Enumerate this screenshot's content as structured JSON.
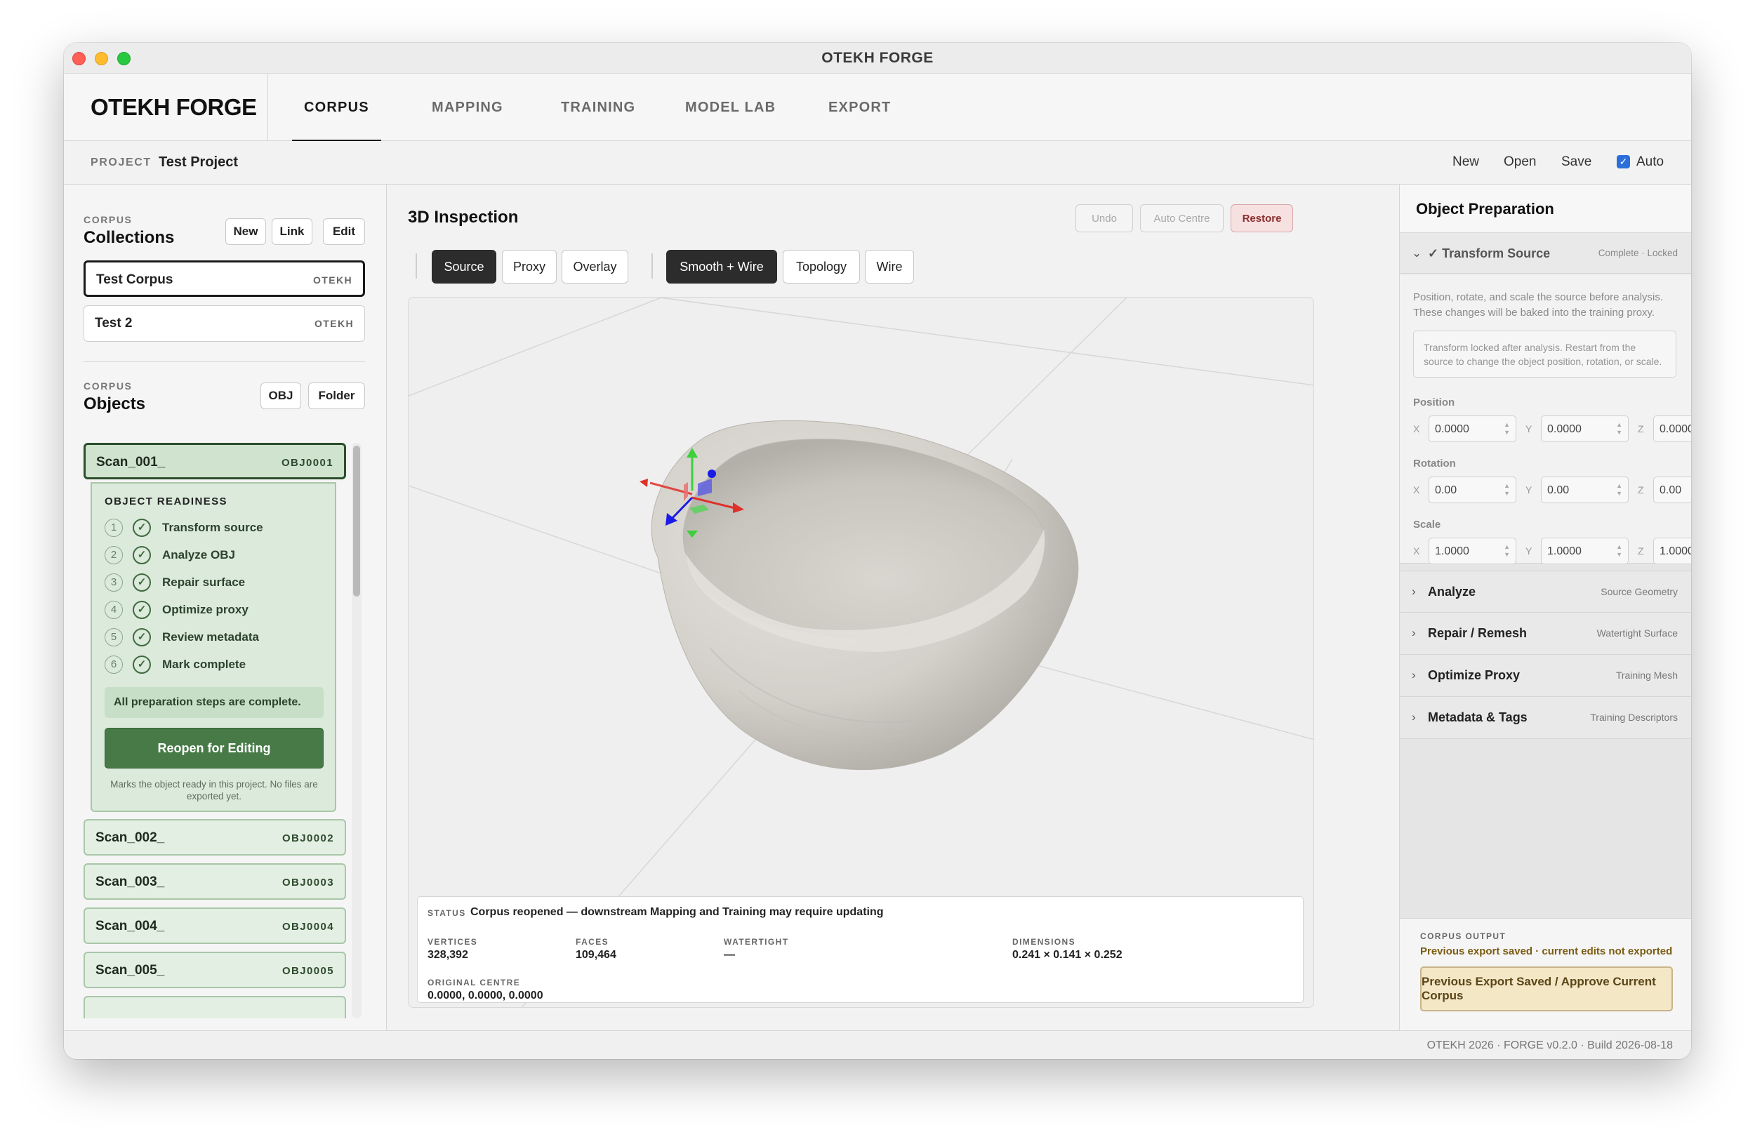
{
  "window": {
    "title": "OTEKH FORGE"
  },
  "app": {
    "logo": "OTEKH FORGE"
  },
  "nav": {
    "tabs": [
      "CORPUS",
      "MAPPING",
      "TRAINING",
      "MODEL LAB",
      "EXPORT"
    ],
    "active": "CORPUS"
  },
  "project": {
    "label": "PROJECT",
    "name": "Test Project",
    "new": "New",
    "open": "Open",
    "save": "Save",
    "auto_label": "Auto",
    "auto_checked": true
  },
  "collections": {
    "section_label": "CORPUS",
    "title": "Collections",
    "buttons": [
      "New",
      "Link",
      "Edit"
    ],
    "items": [
      {
        "name": "Test Corpus",
        "code": "OTEKH",
        "active": true
      },
      {
        "name": "Test 2",
        "code": "OTEKH",
        "active": false
      }
    ]
  },
  "objects": {
    "section_label": "CORPUS",
    "title": "Objects",
    "buttons": [
      "OBJ",
      "Folder"
    ],
    "items": [
      {
        "name": "Scan_001_",
        "code": "OBJ0001",
        "active": true
      },
      {
        "name": "Scan_002_",
        "code": "OBJ0002",
        "active": false
      },
      {
        "name": "Scan_003_",
        "code": "OBJ0003",
        "active": false
      },
      {
        "name": "Scan_004_",
        "code": "OBJ0004",
        "active": false
      },
      {
        "name": "Scan_005_",
        "code": "OBJ0005",
        "active": false
      }
    ],
    "readiness": {
      "title": "OBJECT READINESS",
      "steps": [
        {
          "num": "1",
          "label": "Transform source"
        },
        {
          "num": "2",
          "label": "Analyze OBJ"
        },
        {
          "num": "3",
          "label": "Repair surface"
        },
        {
          "num": "4",
          "label": "Optimize proxy"
        },
        {
          "num": "5",
          "label": "Review metadata"
        },
        {
          "num": "6",
          "label": "Mark complete"
        }
      ],
      "complete_message": "All preparation steps are complete.",
      "reopen_button": "Reopen for Editing",
      "note": "Marks the object ready in this project. No files are exported yet."
    }
  },
  "inspection": {
    "title": "3D Inspection",
    "toolbar": {
      "undo": "Undo",
      "auto_centre": "Auto Centre",
      "restore": "Restore"
    },
    "source_modes": [
      "Source",
      "Proxy",
      "Overlay"
    ],
    "source_active": "Source",
    "render_modes": [
      "Smooth + Wire",
      "Topology",
      "Wire"
    ],
    "render_active": "Smooth + Wire",
    "status": {
      "label": "STATUS",
      "message": "Corpus reopened — downstream Mapping and Training may require updating",
      "vertices_label": "VERTICES",
      "vertices": "328,392",
      "faces_label": "FACES",
      "faces": "109,464",
      "watertight_label": "WATERTIGHT",
      "watertight": "—",
      "dimensions_label": "DIMENSIONS",
      "dimensions": "0.241 × 0.141 × 0.252",
      "centre_label": "ORIGINAL CENTRE",
      "centre": "0.0000, 0.0000, 0.0000"
    },
    "colors": {
      "mesh": "#d6d3ce",
      "axis_x": "#e0302a",
      "axis_y": "#3ad13a",
      "axis_z": "#1b1be6"
    }
  },
  "object_prep": {
    "title": "Object Preparation",
    "transform": {
      "title": "Transform Source",
      "status": "Complete · Locked",
      "description": "Position, rotate, and scale the source before analysis. These changes will be baked into the training proxy.",
      "locked_note": "Transform locked after analysis. Restart from the source to change the object position, rotation, or scale.",
      "position_label": "Position",
      "rotation_label": "Rotation",
      "scale_label": "Scale",
      "axes": [
        "X",
        "Y",
        "Z"
      ],
      "position": [
        "0.0000",
        "0.0000",
        "0.0000"
      ],
      "rotation": [
        "0.00",
        "0.00",
        "0.00"
      ],
      "scale": [
        "1.0000",
        "1.0000",
        "1.0000"
      ]
    },
    "sections": [
      {
        "title": "Analyze",
        "subtitle": "Source Geometry"
      },
      {
        "title": "Repair / Remesh",
        "subtitle": "Watertight Surface"
      },
      {
        "title": "Optimize Proxy",
        "subtitle": "Training Mesh"
      },
      {
        "title": "Metadata & Tags",
        "subtitle": "Training Descriptors"
      }
    ]
  },
  "corpus_output": {
    "label": "CORPUS OUTPUT",
    "status": "Previous export saved · current edits not exported",
    "button": "Previous Export Saved / Approve Current Corpus"
  },
  "footer": {
    "text": "OTEKH 2026 · FORGE v0.2.0 · Build 2026-08-18"
  }
}
